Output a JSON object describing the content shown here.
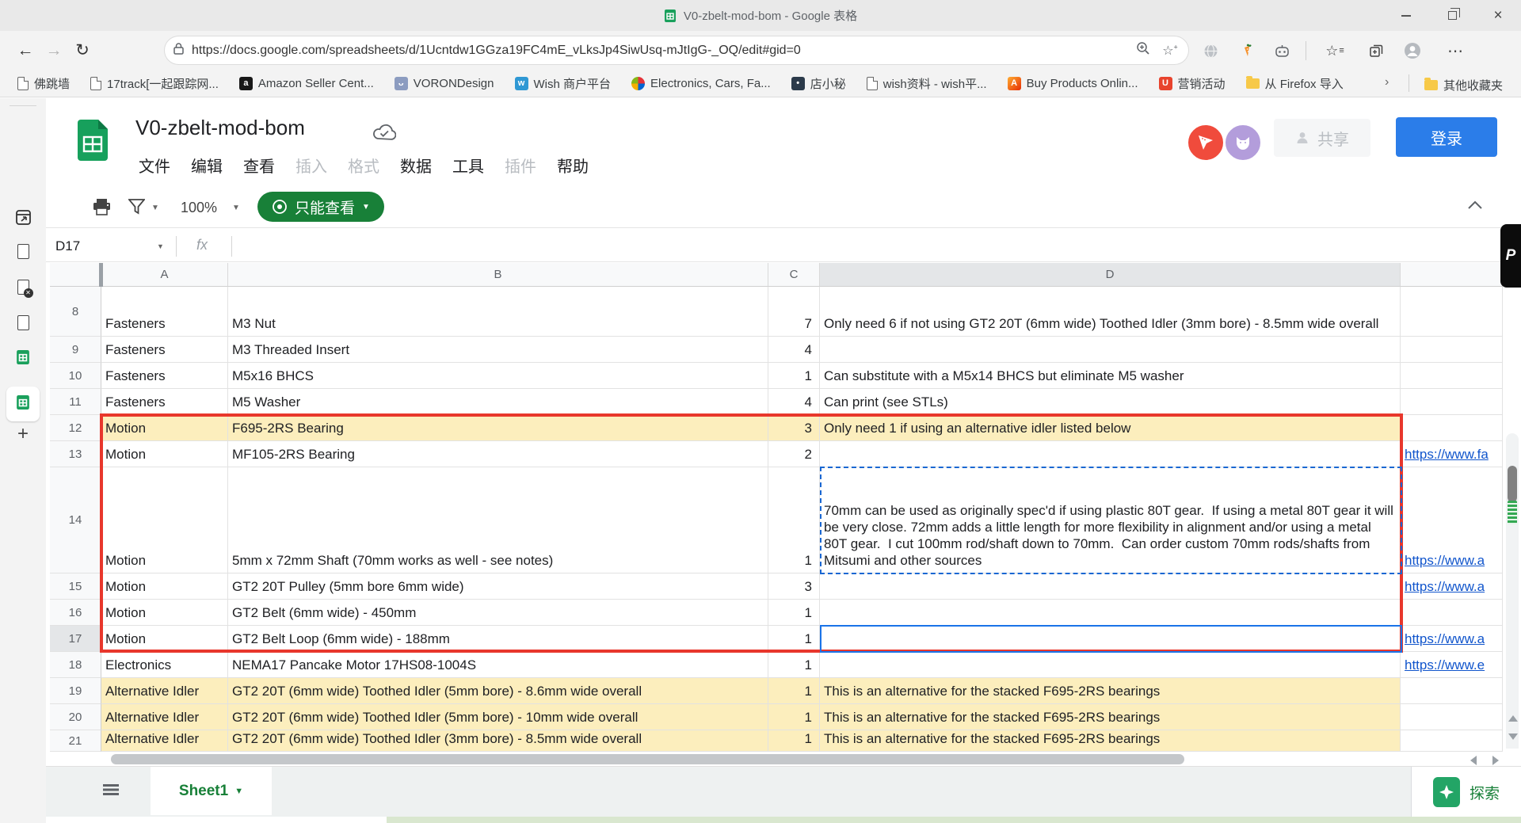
{
  "browser": {
    "window_title": "V0-zbelt-mod-bom - Google 表格",
    "url": "https://docs.google.com/spreadsheets/d/1Ucntdw1GGza19FC4mE_vLksJp4SiwUsq-mJtIgG-_OQ/edit#gid=0",
    "bookmarks": [
      {
        "label": "佛跳墙",
        "icon": "page-icon"
      },
      {
        "label": "17track[一起跟踪网...",
        "icon": "page-icon"
      },
      {
        "label": "Amazon Seller Cent...",
        "icon": "amazon-icon"
      },
      {
        "label": "VORONDesign",
        "icon": "discord-icon"
      },
      {
        "label": "Wish 商户平台",
        "icon": "wish-icon"
      },
      {
        "label": "Electronics, Cars, Fa...",
        "icon": "ebay-icon"
      },
      {
        "label": "店小秘",
        "icon": "dianxiaomi-icon"
      },
      {
        "label": "wish资料 - wish平...",
        "icon": "page-icon"
      },
      {
        "label": "Buy Products Onlin...",
        "icon": "aliexpress-icon"
      },
      {
        "label": "营销活动",
        "icon": "uc-icon"
      },
      {
        "label": "从 Firefox 导入",
        "icon": "folder-icon"
      }
    ],
    "more_bookmarks_label": "其他收藏夹"
  },
  "sheets": {
    "doc_title": "V0-zbelt-mod-bom",
    "menus": [
      {
        "label": "文件",
        "enabled": true
      },
      {
        "label": "编辑",
        "enabled": true
      },
      {
        "label": "查看",
        "enabled": true
      },
      {
        "label": "插入",
        "enabled": false
      },
      {
        "label": "格式",
        "enabled": false
      },
      {
        "label": "数据",
        "enabled": true
      },
      {
        "label": "工具",
        "enabled": true
      },
      {
        "label": "插件",
        "enabled": false
      },
      {
        "label": "帮助",
        "enabled": true
      }
    ],
    "zoom_level": "100%",
    "view_mode_label": "只能查看",
    "share_label": "共享",
    "signin_label": "登录",
    "name_box": "D17",
    "formula_prefix": "fx",
    "sheet_tab": "Sheet1",
    "explore_label": "探索"
  },
  "grid": {
    "column_headers": [
      "A",
      "B",
      "C",
      "D"
    ],
    "selection": {
      "cell": "D17",
      "column": "D",
      "row": "17"
    },
    "rows": [
      {
        "num": "8",
        "category": "Fasteners",
        "item": "M3 Nut",
        "qty": "7",
        "notes": "Only need 6 if not using GT2 20T (6mm wide) Toothed Idler (3mm bore) - 8.5mm wide overall",
        "link": "",
        "yellow": false
      },
      {
        "num": "9",
        "category": "Fasteners",
        "item": "M3 Threaded Insert",
        "qty": "4",
        "notes": "",
        "link": "",
        "yellow": false
      },
      {
        "num": "10",
        "category": "Fasteners",
        "item": "M5x16 BHCS",
        "qty": "1",
        "notes": "Can substitute with a M5x14 BHCS but eliminate M5 washer",
        "link": "",
        "yellow": false
      },
      {
        "num": "11",
        "category": "Fasteners",
        "item": "M5 Washer",
        "qty": "4",
        "notes": "Can print (see STLs)",
        "link": "",
        "yellow": false
      },
      {
        "num": "12",
        "category": "Motion",
        "item": "F695-2RS Bearing",
        "qty": "3",
        "notes": "Only need 1 if using an alternative idler listed below",
        "link": "",
        "yellow": true
      },
      {
        "num": "13",
        "category": "Motion",
        "item": "MF105-2RS Bearing",
        "qty": "2",
        "notes": "",
        "link": "https://www.fa",
        "yellow": false
      },
      {
        "num": "14",
        "category": "Motion",
        "item": "5mm x 72mm Shaft (70mm works as well - see notes)",
        "qty": "1",
        "notes": "70mm can be used as originally spec'd if using plastic 80T gear.  If using a metal 80T gear it will be very close. 72mm adds a little length for more flexibility in alignment and/or using a metal 80T gear.  I cut 100mm rod/shaft down to 70mm.  Can order custom 70mm rods/shafts from Mitsumi and other sources",
        "link": "https://www.a",
        "yellow": false
      },
      {
        "num": "15",
        "category": "Motion",
        "item": "GT2 20T Pulley (5mm bore 6mm wide)",
        "qty": "3",
        "notes": "",
        "link": "https://www.a",
        "yellow": false
      },
      {
        "num": "16",
        "category": "Motion",
        "item": "GT2 Belt (6mm wide) - 450mm",
        "qty": "1",
        "notes": "",
        "link": "",
        "yellow": false
      },
      {
        "num": "17",
        "category": "Motion",
        "item": "GT2 Belt Loop (6mm wide) - 188mm",
        "qty": "1",
        "notes": "",
        "link": "https://www.a",
        "yellow": false
      },
      {
        "num": "18",
        "category": "Electronics",
        "item": "NEMA17 Pancake Motor 17HS08-1004S",
        "qty": "1",
        "notes": "",
        "link": "https://www.e",
        "yellow": false
      },
      {
        "num": "19",
        "category": "Alternative Idler",
        "item": "GT2 20T (6mm wide) Toothed Idler (5mm bore) - 8.6mm wide overall",
        "qty": "1",
        "notes": "This is an alternative for the stacked F695-2RS bearings",
        "link": "",
        "yellow": true
      },
      {
        "num": "20",
        "category": "Alternative Idler",
        "item": "GT2 20T (6mm wide) Toothed Idler (5mm bore) - 10mm wide overall",
        "qty": "1",
        "notes": "This is an alternative for the stacked F695-2RS bearings",
        "link": "",
        "yellow": true
      },
      {
        "num": "21",
        "category": "Alternative Idler",
        "item": "GT2 20T (6mm wide) Toothed Idler (3mm bore) - 8.5mm wide overall",
        "qty": "1",
        "notes": "This is an alternative for the stacked F695-2RS bearings",
        "link": "",
        "yellow": true
      }
    ]
  },
  "colors": {
    "accent_green": "#188038",
    "signin_blue": "#2b7de9",
    "highlight_yellow": "#fceebd",
    "range_red": "#e8372c",
    "link_blue": "#1155cc"
  }
}
